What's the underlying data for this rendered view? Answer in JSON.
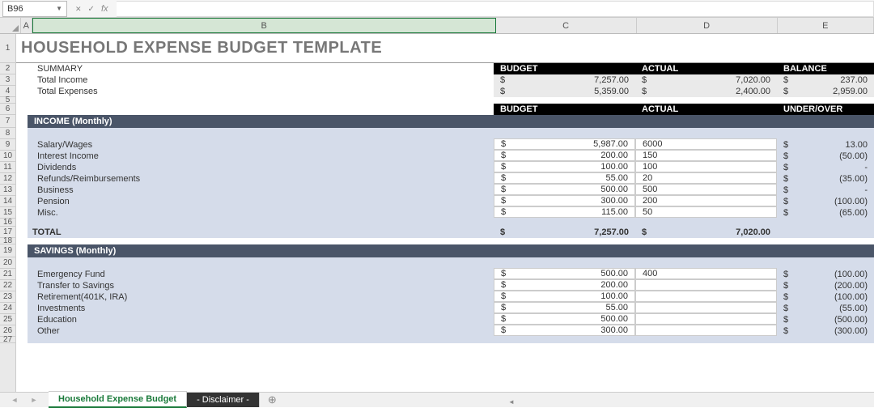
{
  "formula": {
    "cellRef": "B96"
  },
  "cols": {
    "A": "A",
    "B": "B",
    "C": "C",
    "D": "D",
    "E": "E"
  },
  "rows": [
    "1",
    "2",
    "3",
    "4",
    "5",
    "6",
    "7",
    "8",
    "9",
    "10",
    "11",
    "12",
    "13",
    "14",
    "15",
    "16",
    "17",
    "18",
    "19",
    "20",
    "21",
    "22",
    "23",
    "24",
    "25",
    "26",
    "27"
  ],
  "title": "HOUSEHOLD EXPENSE BUDGET TEMPLATE",
  "summary": {
    "label": "SUMMARY",
    "headers": {
      "budget": "BUDGET",
      "actual": "ACTUAL",
      "balance": "BALANCE"
    },
    "rows": [
      {
        "label": "Total Income",
        "budget": "7,257.00",
        "actual": "7,020.00",
        "balance": "237.00"
      },
      {
        "label": "Total Expenses",
        "budget": "5,359.00",
        "actual": "2,400.00",
        "balance": "2,959.00"
      }
    ]
  },
  "subheaders": {
    "budget": "BUDGET",
    "actual": "ACTUAL",
    "underover": "UNDER/OVER"
  },
  "income": {
    "header": "INCOME (Monthly)",
    "items": [
      {
        "label": "Salary/Wages",
        "budget": "5,987.00",
        "actual": "6000",
        "uo": "13.00"
      },
      {
        "label": "Interest Income",
        "budget": "200.00",
        "actual": "150",
        "uo": "(50.00)"
      },
      {
        "label": "Dividends",
        "budget": "100.00",
        "actual": "100",
        "uo": "-"
      },
      {
        "label": "Refunds/Reimbursements",
        "budget": "55.00",
        "actual": "20",
        "uo": "(35.00)"
      },
      {
        "label": "Business",
        "budget": "500.00",
        "actual": "500",
        "uo": "-"
      },
      {
        "label": "Pension",
        "budget": "300.00",
        "actual": "200",
        "uo": "(100.00)"
      },
      {
        "label": "Misc.",
        "budget": "115.00",
        "actual": "50",
        "uo": "(65.00)"
      }
    ],
    "total": {
      "label": "TOTAL",
      "budget": "7,257.00",
      "actual": "7,020.00"
    }
  },
  "savings": {
    "header": "SAVINGS (Monthly)",
    "items": [
      {
        "label": "Emergency Fund",
        "budget": "500.00",
        "actual": "400",
        "uo": "(100.00)"
      },
      {
        "label": "Transfer to Savings",
        "budget": "200.00",
        "actual": "",
        "uo": "(200.00)"
      },
      {
        "label": "Retirement(401K, IRA)",
        "budget": "100.00",
        "actual": "",
        "uo": "(100.00)"
      },
      {
        "label": "Investments",
        "budget": "55.00",
        "actual": "",
        "uo": "(55.00)"
      },
      {
        "label": "Education",
        "budget": "500.00",
        "actual": "",
        "uo": "(500.00)"
      },
      {
        "label": "Other",
        "budget": "300.00",
        "actual": "",
        "uo": "(300.00)"
      }
    ]
  },
  "tabs": {
    "t1": "Household Expense Budget",
    "t2": "- Disclaimer -"
  },
  "currency": "$"
}
